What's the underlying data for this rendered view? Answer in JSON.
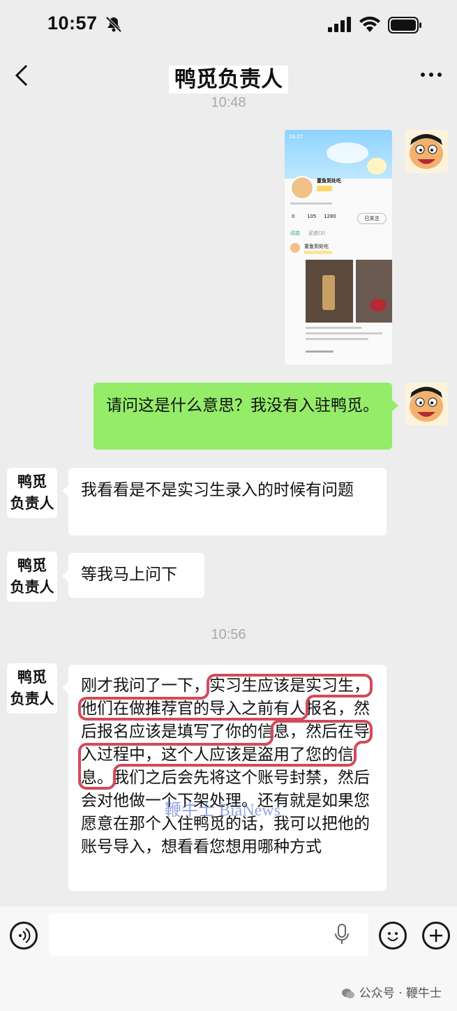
{
  "status": {
    "time": "10:57"
  },
  "nav": {
    "title": "鸭觅负责人"
  },
  "chat": {
    "timestamps": [
      "10:48",
      "10:56"
    ],
    "other_name": "鸭觅\n负责人",
    "messages": [
      {
        "from": "me",
        "type": "image"
      },
      {
        "from": "me",
        "text": "请问这是什么意思？我没有入驻鸭觅。"
      },
      {
        "from": "other",
        "text": "我看看是不是实习生录入的时候有问题"
      },
      {
        "from": "other",
        "text": "等我马上问下"
      },
      {
        "from": "other",
        "segments": [
          "刚才我问了一下，",
          "实习生应该是实习生，他们在做推荐官的导入之前有人",
          "报名，然后报名应该是填写了你的信",
          "息，然后在导入过程中，这个人应该是盗用了您的信息。",
          "我们之后会先将这个账号封禁，然后会对他做一个下架处理。还有就是如果您愿意在那个入住鸭觅的话，我可以把他的账号导入，想看看您想用哪种方式"
        ]
      }
    ]
  },
  "screenshot": {
    "time": "10:27",
    "name": "童鱼到处吃",
    "stats": [
      "0",
      "105",
      "1280"
    ],
    "follow": "已关注",
    "tabs": [
      "动态",
      "足迹(3)"
    ],
    "post_author": "童鱼到处吃"
  },
  "watermark": "鞭牛士 BiaNews",
  "footer": "公众号 · 鞭牛士",
  "colors": {
    "green_bubble": "#95ec69",
    "highlight": "#d24a5a",
    "background": "#ededed"
  }
}
